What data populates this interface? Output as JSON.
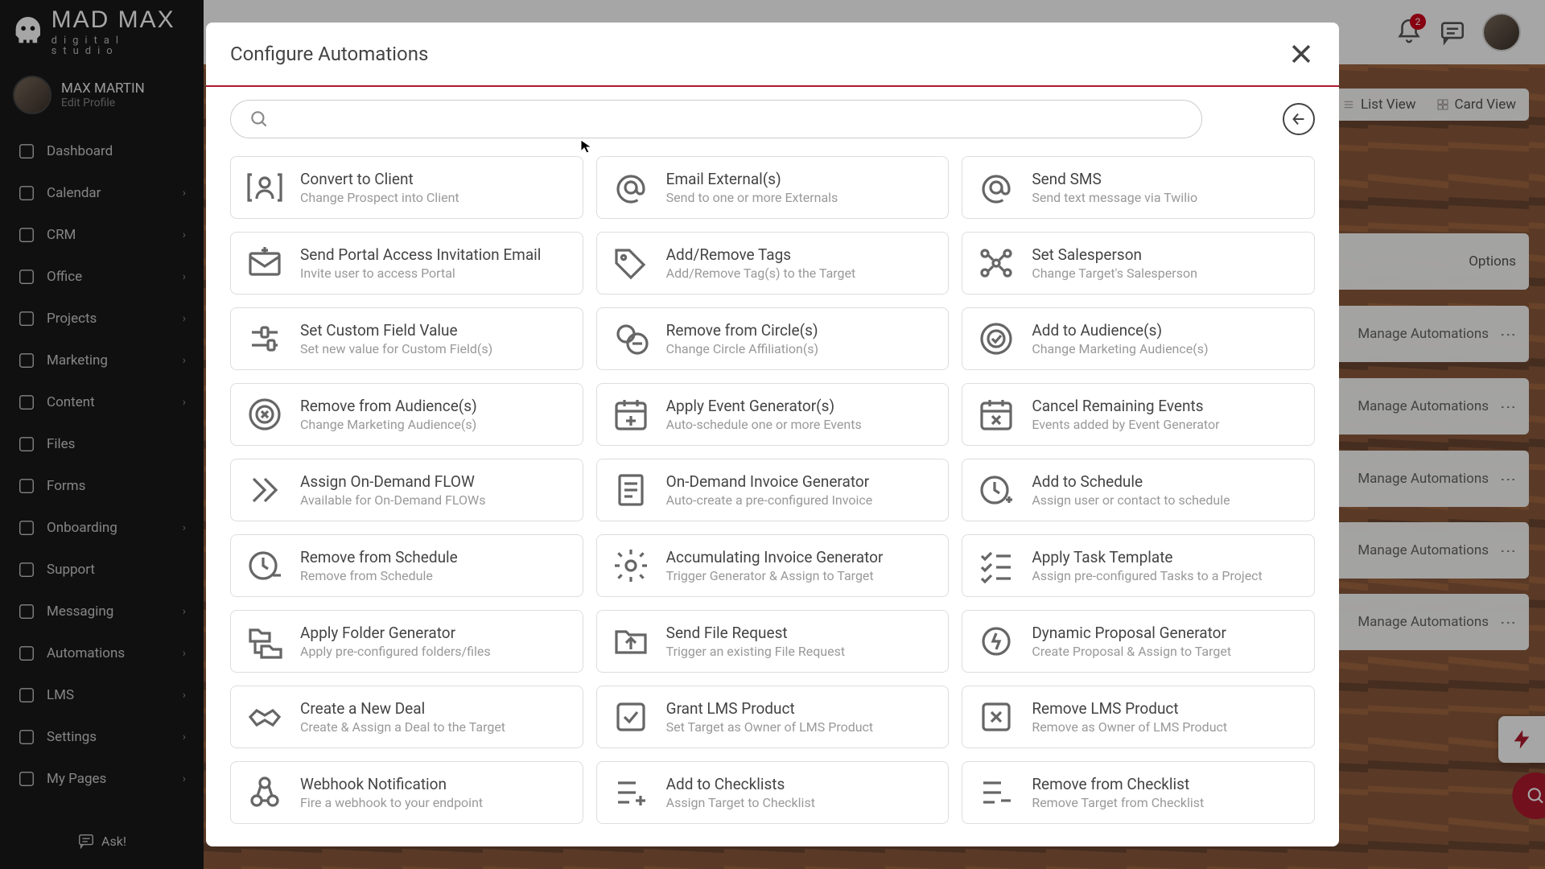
{
  "brand": {
    "main": "MAD MAX",
    "sub": "digital studio"
  },
  "user": {
    "name": "MAX MARTIN",
    "edit": "Edit Profile"
  },
  "nav": [
    {
      "label": "Dashboard",
      "chev": false,
      "icon": "grid"
    },
    {
      "label": "Calendar",
      "chev": true,
      "icon": "calendar"
    },
    {
      "label": "CRM",
      "chev": true,
      "icon": "people"
    },
    {
      "label": "Office",
      "chev": true,
      "icon": "briefcase"
    },
    {
      "label": "Projects",
      "chev": true,
      "icon": "layers"
    },
    {
      "label": "Marketing",
      "chev": true,
      "icon": "flame"
    },
    {
      "label": "Content",
      "chev": true,
      "icon": "folder"
    },
    {
      "label": "Files",
      "chev": false,
      "icon": "folder"
    },
    {
      "label": "Forms",
      "chev": false,
      "icon": "list"
    },
    {
      "label": "Onboarding",
      "chev": true,
      "icon": "check"
    },
    {
      "label": "Support",
      "chev": false,
      "icon": "headset"
    },
    {
      "label": "Messaging",
      "chev": true,
      "icon": "at"
    },
    {
      "label": "Automations",
      "chev": true,
      "icon": "bolt"
    },
    {
      "label": "LMS",
      "chev": true,
      "icon": "book"
    },
    {
      "label": "Settings",
      "chev": true,
      "icon": "gear"
    },
    {
      "label": "My Pages",
      "chev": true,
      "icon": "page"
    }
  ],
  "ask": "Ask!",
  "topbar": {
    "badge": "2"
  },
  "viewbar": {
    "list": "List View",
    "card": "Card View",
    "options": "Options"
  },
  "rows": {
    "manage": "Manage Automations"
  },
  "modal": {
    "title": "Configure Automations",
    "search_placeholder": "",
    "cards": [
      {
        "t": "Convert to Client",
        "s": "Change Prospect into Client",
        "i": "user-bracket"
      },
      {
        "t": "Email External(s)",
        "s": "Send to one or more Externals",
        "i": "at"
      },
      {
        "t": "Send SMS",
        "s": "Send text message via Twilio",
        "i": "at"
      },
      {
        "t": "Send Portal Access Invitation Email",
        "s": "Invite user to access Portal",
        "i": "mail-plus"
      },
      {
        "t": "Add/Remove Tags",
        "s": "Add/Remove Tag(s) to the Target",
        "i": "tag"
      },
      {
        "t": "Set Salesperson",
        "s": "Change Target's Salesperson",
        "i": "nodes"
      },
      {
        "t": "Set Custom Field Value",
        "s": "Set new value for Custom Field(s)",
        "i": "slider"
      },
      {
        "t": "Remove from Circle(s)",
        "s": "Change Circle Affiliation(s)",
        "i": "circle-minus"
      },
      {
        "t": "Add to Audience(s)",
        "s": "Change Marketing Audience(s)",
        "i": "target-check"
      },
      {
        "t": "Remove from Audience(s)",
        "s": "Change Marketing Audience(s)",
        "i": "target-x"
      },
      {
        "t": "Apply Event Generator(s)",
        "s": "Auto-schedule one or more Events",
        "i": "cal-plus"
      },
      {
        "t": "Cancel Remaining Events",
        "s": "Events added by Event Generator",
        "i": "cal-x"
      },
      {
        "t": "Assign On-Demand FLOW",
        "s": "Available for On-Demand FLOWs",
        "i": "chevrons"
      },
      {
        "t": "On-Demand Invoice Generator",
        "s": "Auto-create a pre-configured Invoice",
        "i": "invoice"
      },
      {
        "t": "Add to Schedule",
        "s": "Assign user or contact to schedule",
        "i": "clock-plus"
      },
      {
        "t": "Remove from Schedule",
        "s": "Remove from Schedule",
        "i": "clock-minus"
      },
      {
        "t": "Accumulating Invoice Generator",
        "s": "Trigger Generator & Assign to Target",
        "i": "gear"
      },
      {
        "t": "Apply Task Template",
        "s": "Assign pre-configured Tasks to a Project",
        "i": "checklist"
      },
      {
        "t": "Apply Folder Generator",
        "s": "Apply pre-configured folders/files",
        "i": "folder-tree"
      },
      {
        "t": "Send File Request",
        "s": "Trigger an existing File Request",
        "i": "folder-up"
      },
      {
        "t": "Dynamic Proposal Generator",
        "s": "Create Proposal & Assign to Target",
        "i": "gear-bolt"
      },
      {
        "t": "Create a New Deal",
        "s": "Create & Assign a Deal to the Target",
        "i": "handshake"
      },
      {
        "t": "Grant LMS Product",
        "s": "Set Target as Owner of LMS Product",
        "i": "box-check"
      },
      {
        "t": "Remove LMS Product",
        "s": "Remove as Owner of LMS Product",
        "i": "box-x"
      },
      {
        "t": "Webhook Notification",
        "s": "Fire a webhook to your endpoint",
        "i": "webhook"
      },
      {
        "t": "Add to Checklists",
        "s": "Assign Target to Checklist",
        "i": "list-plus"
      },
      {
        "t": "Remove from Checklist",
        "s": "Remove Target from Checklist",
        "i": "list-minus"
      }
    ]
  }
}
